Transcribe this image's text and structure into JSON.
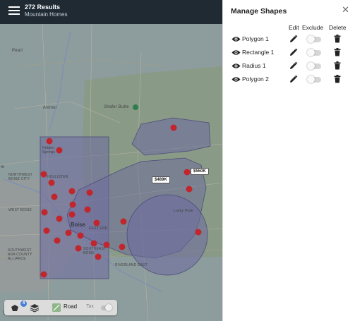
{
  "header": {
    "results": "272 Results",
    "location": "Mountain Homes"
  },
  "map": {
    "labels": {
      "pearl": "Pearl",
      "avimor": "Avimor",
      "shafer_butte": "Shafer Butte",
      "hidden_springs": "Hidden Springs",
      "northwest_boise": "NORTHWEST BOISE CITY",
      "hollister": "HOLLISTER",
      "west_boise": "WEST BOISE",
      "boise": "Boise",
      "east_end": "EAST END",
      "southwest_ada": "SOUTHWEST ADA COUNTY ALLIANCE",
      "southeast_boise": "SOUTHEAST BOISE",
      "riverland_east": "RIVERLAND EAST",
      "lucky_peak": "Lucky Peak",
      "le": "le",
      "gle": "gle"
    },
    "price_tags": [
      "$550K",
      "$489K"
    ]
  },
  "panel": {
    "title": "Manage Shapes",
    "columns": {
      "edit": "Edit",
      "exclude": "Exclude",
      "delete": "Delete"
    },
    "shapes": [
      {
        "name": "Polygon 1"
      },
      {
        "name": "Rectangle 1"
      },
      {
        "name": "Radius 1"
      },
      {
        "name": "Polygon 2"
      }
    ]
  },
  "bottom_bar": {
    "badge_count": "4",
    "road_label": "Road",
    "tax_label": "Tax"
  },
  "colors": {
    "header_bg": "#1f2a33",
    "shape_fill": "#6b6a9e",
    "marker": "#c0262c",
    "badge": "#4a7fd1"
  }
}
